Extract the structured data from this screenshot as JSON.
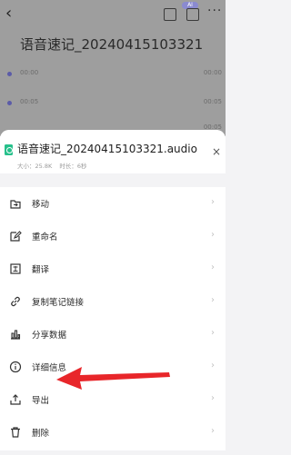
{
  "background": {
    "title": "语音速记_20240415103321",
    "badge": "AI",
    "rows": [
      {
        "time": "00:00",
        "right": "00:00"
      },
      {
        "time": "00:05",
        "right": "00:05"
      },
      {
        "time": "",
        "right": "00:05"
      }
    ]
  },
  "sheet": {
    "file_name": "语音速记_20240415103321.audio",
    "size_label": "大小：25.8K",
    "duration_label": "时长：6秒",
    "close_label": "×"
  },
  "menu": {
    "items": [
      {
        "label": "移动",
        "icon": "move-icon"
      },
      {
        "label": "重命名",
        "icon": "rename-icon"
      },
      {
        "label": "翻译",
        "icon": "translate-icon"
      },
      {
        "label": "复制笔记链接",
        "icon": "link-icon"
      },
      {
        "label": "分享数据",
        "icon": "chart-icon"
      },
      {
        "label": "详细信息",
        "icon": "info-icon"
      },
      {
        "label": "导出",
        "icon": "export-icon"
      },
      {
        "label": "删除",
        "icon": "delete-icon"
      }
    ],
    "arrow_glyph": "›"
  },
  "colors": {
    "annotation_arrow": "#e8262a",
    "file_icon": "#27c08b"
  }
}
